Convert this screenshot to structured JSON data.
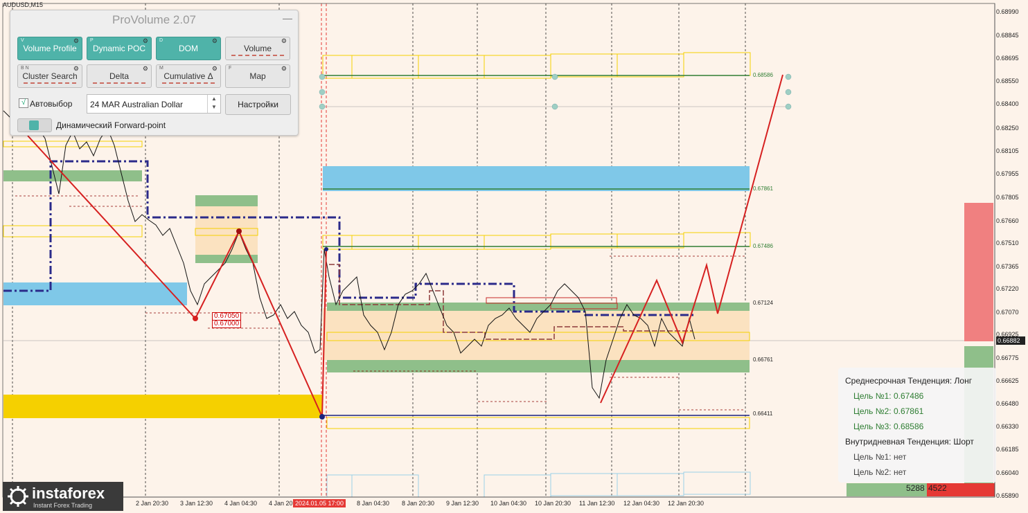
{
  "symbol": "AUDUSD,M15",
  "panel": {
    "title": "ProVolume 2.07",
    "buttons": [
      {
        "key": "V",
        "label": "Volume Profile",
        "style": "teal"
      },
      {
        "key": "P",
        "label": "Dynamic POC",
        "style": "teal"
      },
      {
        "key": "D",
        "label": "DOM",
        "style": "teal"
      },
      {
        "key": "",
        "label": "Volume",
        "style": "gray"
      },
      {
        "key": "B N",
        "label": "Cluster Search",
        "style": "gray"
      },
      {
        "key": "",
        "label": "Delta",
        "style": "gray"
      },
      {
        "key": "M",
        "label": "Cumulative Δ",
        "style": "gray"
      },
      {
        "key": "F",
        "label": "Map",
        "style": "gray"
      }
    ],
    "autoselect_label": "Автовыбор",
    "autoselect_checked": "√",
    "instrument": "24 MAR Australian Dollar",
    "settings_label": "Настройки",
    "forward_point_label": "Динамический Forward-point"
  },
  "price_axis": [
    "0.68990",
    "0.68845",
    "0.68695",
    "0.68550",
    "0.68400",
    "0.68250",
    "0.68105",
    "0.67955",
    "0.67805",
    "0.67660",
    "0.67510",
    "0.67365",
    "0.67220",
    "0.67070",
    "0.66925",
    "0.66775",
    "0.66625",
    "0.66480",
    "0.66330",
    "0.66185",
    "0.66040",
    "0.65890"
  ],
  "current_price": "0.66882",
  "time_axis": [
    "2 Jan 20:30",
    "3 Jan 12:30",
    "4 Jan 04:30",
    "4 Jan 20:",
    "8 Jan 04:30",
    "8 Jan 20:30",
    "9 Jan 12:30",
    "10 Jan 04:30",
    "10 Jan 20:30",
    "11 Jan 12:30",
    "12 Jan 04:30",
    "12 Jan 20:30"
  ],
  "time_highlight": "2024.01.05 17:00",
  "levels": [
    "0.68586",
    "0.67861",
    "0.67486",
    "0.67124",
    "0.66761",
    "0.66411"
  ],
  "marks": [
    "0.67050",
    "0.67000"
  ],
  "info": {
    "medium_title": "Среднесрочная Тенденция: Лонг",
    "targets_long": [
      "Цель №1: 0.67486",
      "Цель №2: 0.67861",
      "Цель №3: 0.68586"
    ],
    "intraday_title": "Внутридневная Тенденция: Шорт",
    "targets_short": [
      "Цель №1: нет",
      "Цель №2: нет"
    ]
  },
  "volume_buy": "5288",
  "volume_sell": "4522",
  "logo": {
    "name": "instaforex",
    "tagline": "Instant Forex Trading"
  },
  "colors": {
    "background": "#fdf3ea",
    "teal": "#4fb3a9",
    "green_zone": "#8fbf8a",
    "blue_zone": "#7fc8e8",
    "yellow_zone": "#f5d000",
    "red_line": "#d62020",
    "navy_dash": "#2a2a8a"
  }
}
